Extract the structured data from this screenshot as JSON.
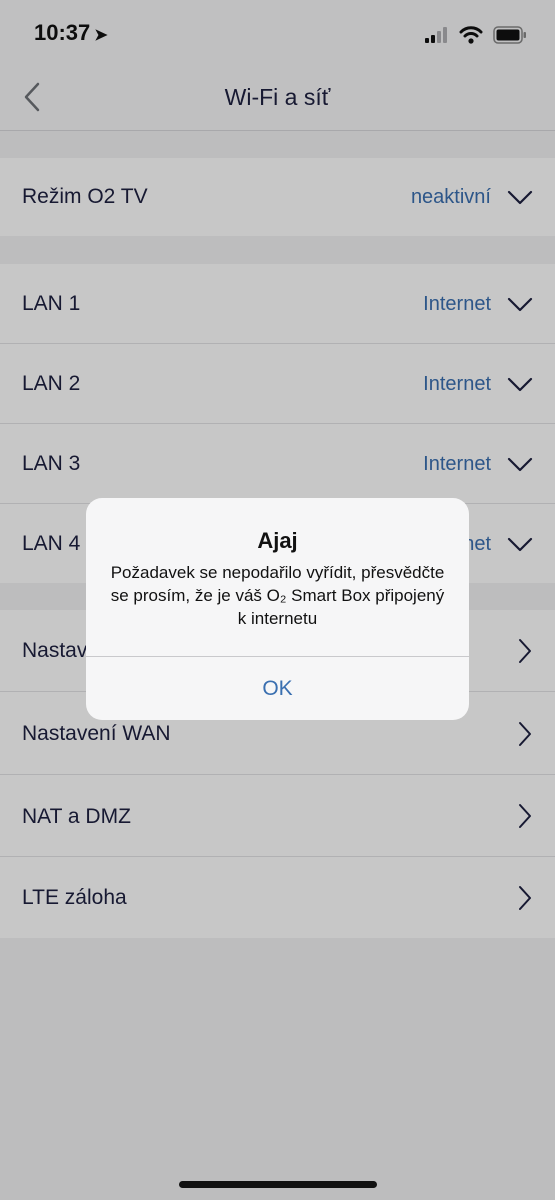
{
  "status_bar": {
    "time": "10:37",
    "location_glyph": "➤"
  },
  "header": {
    "title": "Wi-Fi a síť"
  },
  "o2tv": {
    "label": "Režim O2 TV",
    "value": "neaktivní"
  },
  "lan": [
    {
      "label": "LAN 1",
      "value": "Internet"
    },
    {
      "label": "LAN 2",
      "value": "Internet"
    },
    {
      "label": "LAN 3",
      "value": "Internet"
    },
    {
      "label": "LAN 4",
      "value": "Internet"
    }
  ],
  "settings": [
    {
      "label": "Nastavení DHCP"
    },
    {
      "label": "Nastavení WAN"
    },
    {
      "label": "NAT a DMZ"
    },
    {
      "label": "LTE záloha"
    }
  ],
  "alert": {
    "title": "Ajaj",
    "message": "Požadavek se nepodařilo vyřídit, přesvědčte se prosím, že je váš O₂ Smart Box připojený k internetu",
    "ok": "OK"
  },
  "colors": {
    "accent": "#3a6fb0",
    "text": "#1e2140",
    "background": "#f2f2f4"
  }
}
